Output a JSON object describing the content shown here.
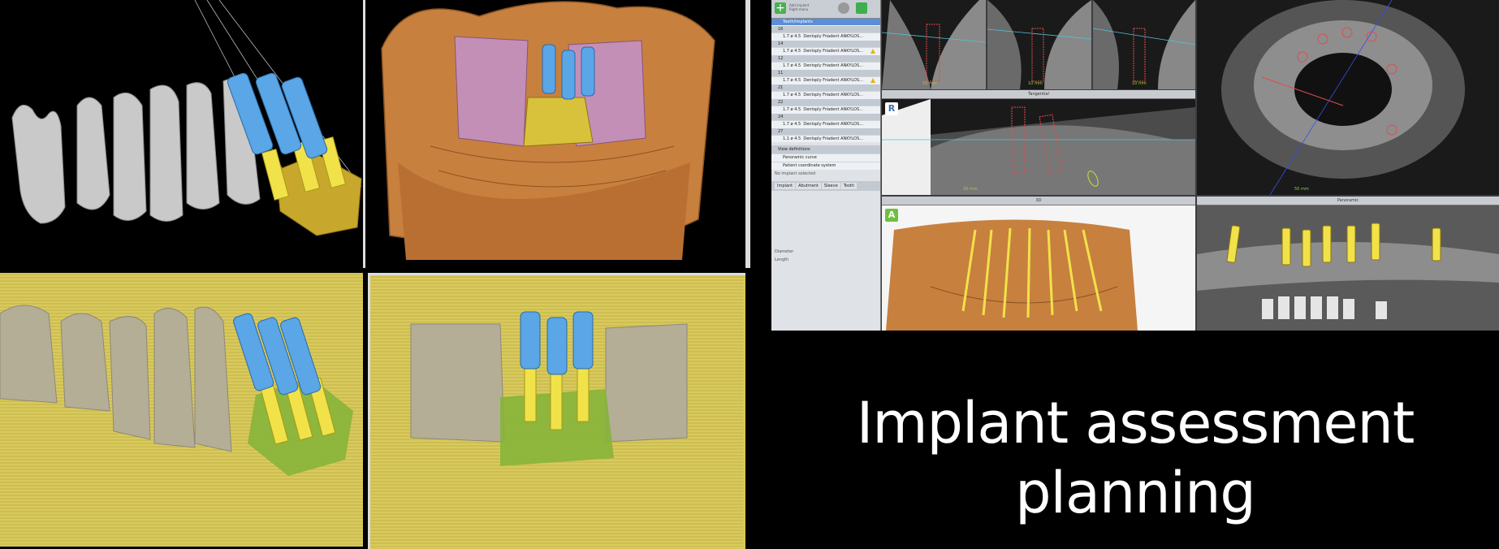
{
  "software": {
    "toolbar": {
      "menu_a": "Add implant",
      "menu_b": "Right menu"
    },
    "tree_header": "Teeth/Implants",
    "teeth": [
      {
        "tooth": "16",
        "implant": "1.7 ø 4.5",
        "product": "Dentsply Friadent ANKYLOS..."
      },
      {
        "tooth": "14",
        "implant": "1.7 ø 4.5",
        "product": "Dentsply Friadent ANKYLOS..."
      },
      {
        "tooth": "12",
        "implant": "1.7 ø 4.5",
        "product": "Dentsply Friadent ANKYLOS..."
      },
      {
        "tooth": "11",
        "implant": "1.7 ø 4.5",
        "product": "Dentsply Friadent ANKYLOS..."
      },
      {
        "tooth": "21",
        "implant": "1.7 ø 4.5",
        "product": "Dentsply Friadent ANKYLOS..."
      },
      {
        "tooth": "22",
        "implant": "1.7 ø 4.5",
        "product": "Dentsply Friadent ANKYLOS..."
      },
      {
        "tooth": "24",
        "implant": "1.7 ø 4.5",
        "product": "Dentsply Friadent ANKYLOS..."
      },
      {
        "tooth": "27",
        "implant": "1.1 ø 4.5",
        "product": "Dentsply Friadent ANKYLOS..."
      }
    ],
    "view_definitions": "View definitions",
    "view_options": [
      "Panoramic curve",
      "Patient coordinate system"
    ],
    "selection_note": "No implant selected",
    "tabs": [
      "Implant",
      "Abutment",
      "Sleeve",
      "Tooth"
    ],
    "fields": {
      "diameter": "Diameter",
      "length": "Length"
    },
    "view_titles": {
      "tangential": "Tangential",
      "view_3d": "3D",
      "panoramic": "Panoramic"
    },
    "scale_labels": {
      "slice": "10 mm",
      "tangential": "20 mm",
      "axial": "50 mm"
    },
    "tags": {
      "right": "R",
      "anterior": "A"
    }
  },
  "caption": {
    "line1": "Implant assessment",
    "line2": "planning"
  },
  "colors": {
    "implant_blue": "#5aa6e6",
    "implant_yellow": "#f1e24a",
    "guide_yellow": "#d8c23c",
    "bone": "#c9c9c9",
    "orange_bone": "#c8803f"
  }
}
